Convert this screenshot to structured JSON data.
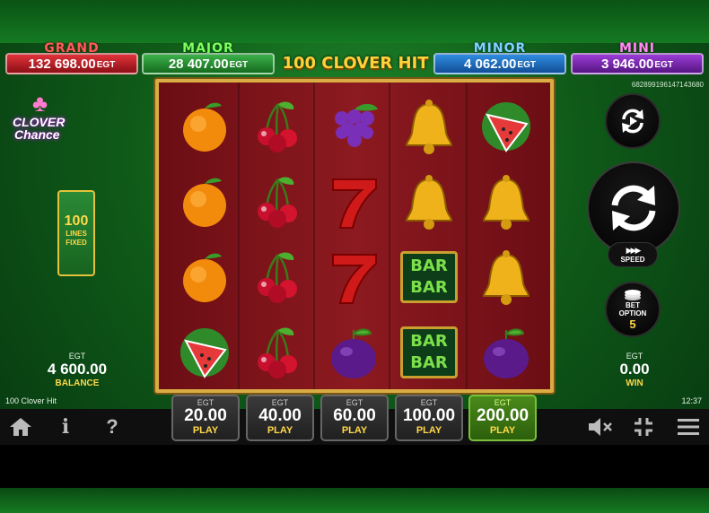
{
  "jackpots": [
    {
      "key": "grand",
      "label": "GRAND",
      "amount": "132 698.00",
      "unit": "EGT"
    },
    {
      "key": "major",
      "label": "MAJOR",
      "amount": "28 407.00",
      "unit": "EGT"
    },
    {
      "key": "minor",
      "label": "MINOR",
      "amount": "4 062.00",
      "unit": "EGT"
    },
    {
      "key": "mini",
      "label": "MINI",
      "amount": "3 946.00",
      "unit": "EGT"
    }
  ],
  "game_title": "100 CLOVER HIT",
  "session_id": "682899196147143680",
  "logo": {
    "line1": "CLOVER",
    "line2": "Chance"
  },
  "lines": {
    "count": "100",
    "label1": "LINES",
    "label2": "FIXED"
  },
  "balance": {
    "currency": "EGT",
    "value": "4 600.00",
    "label": "BALANCE"
  },
  "win": {
    "currency": "EGT",
    "value": "0.00",
    "label": "WIN"
  },
  "reels": [
    [
      "orange",
      "orange",
      "orange",
      "watermelon"
    ],
    [
      "cherry",
      "cherry",
      "cherry",
      "cherry"
    ],
    [
      "grapes",
      "seven",
      "seven",
      "plum"
    ],
    [
      "bell",
      "bell",
      "bar",
      "bar"
    ],
    [
      "watermelon",
      "bell",
      "bell",
      "plum"
    ]
  ],
  "symbols": {
    "bar_text": "BAR"
  },
  "speed_label": "SPEED",
  "bet_option": {
    "label1": "BET",
    "label2": "OPTION",
    "value": "5"
  },
  "game_name": "100 Clover Hit",
  "clock": "12:37",
  "bets": [
    {
      "currency": "EGT",
      "value": "20.00",
      "action": "PLAY",
      "active": false
    },
    {
      "currency": "EGT",
      "value": "40.00",
      "action": "PLAY",
      "active": false
    },
    {
      "currency": "EGT",
      "value": "60.00",
      "action": "PLAY",
      "active": false
    },
    {
      "currency": "EGT",
      "value": "100.00",
      "action": "PLAY",
      "active": false
    },
    {
      "currency": "EGT",
      "value": "200.00",
      "action": "PLAY",
      "active": true
    }
  ],
  "toolbar": {
    "info_label": "i",
    "help_label": "?"
  },
  "colors": {
    "gold": "#ffd94a",
    "frame": "#d9ad44",
    "reel_bg": "#8c1a20"
  }
}
